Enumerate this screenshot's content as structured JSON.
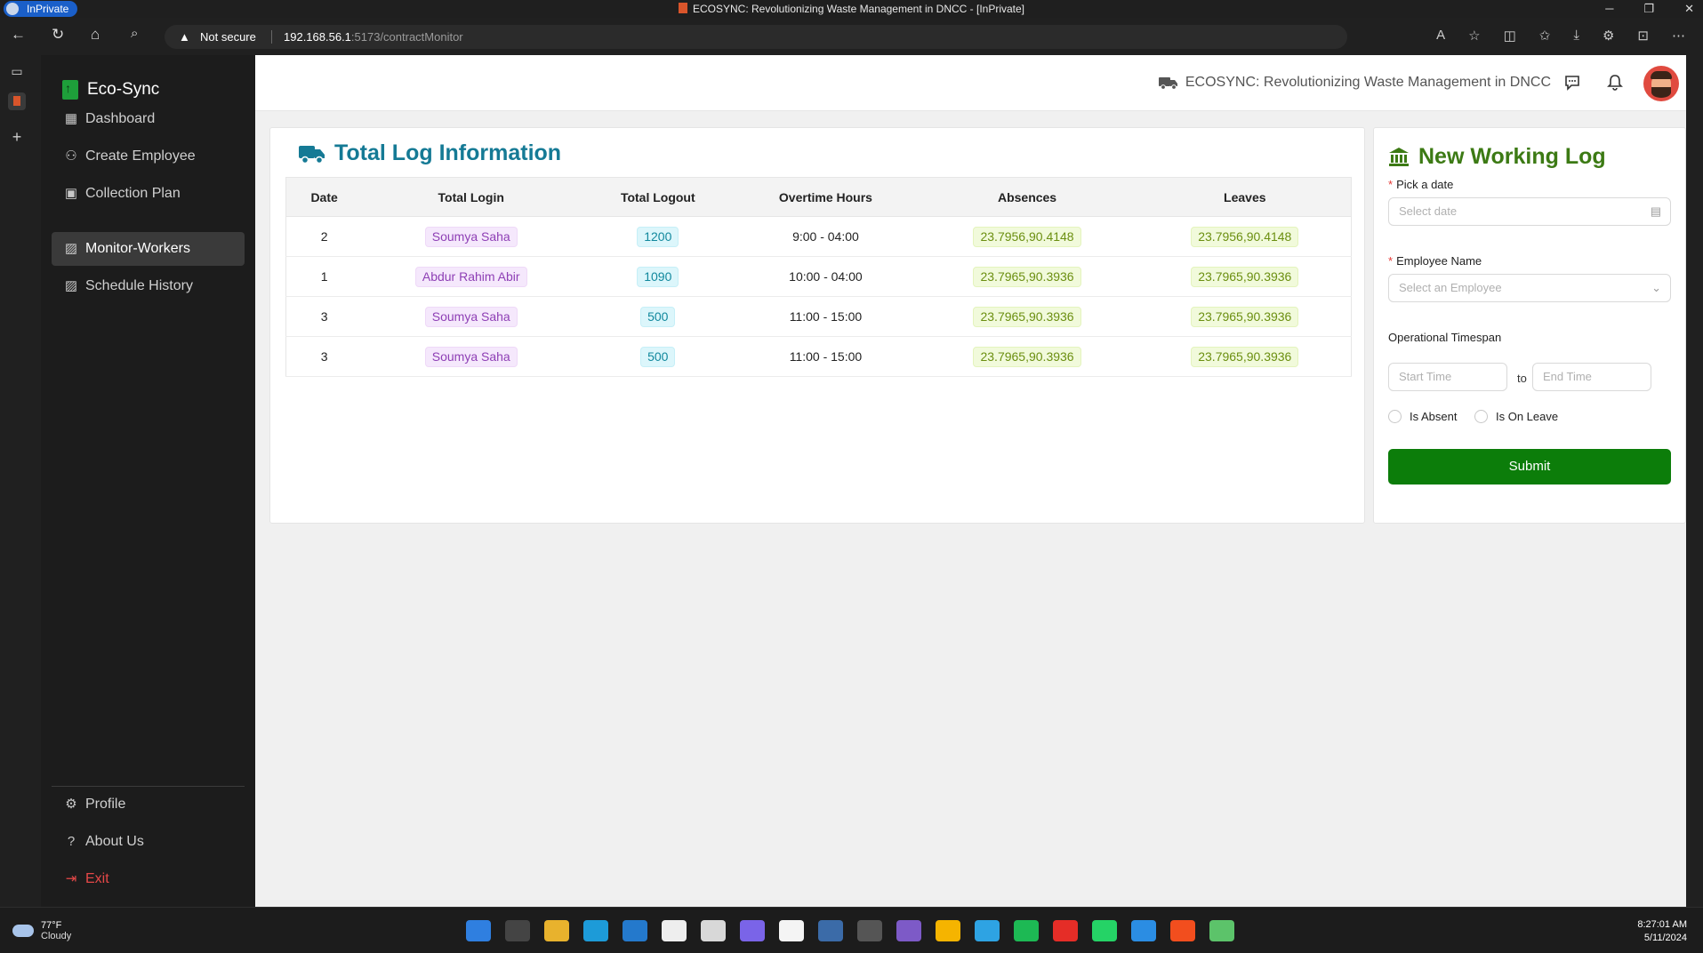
{
  "browser": {
    "inprivate_label": "InPrivate",
    "window_title": "ECOSYNC: Revolutionizing Waste Management in DNCC - [InPrivate]",
    "security_label": "Not secure",
    "url_host": "192.168.56.1",
    "url_path": ":5173/contractMonitor"
  },
  "sidebar": {
    "brand": "Eco-Sync",
    "items": [
      {
        "label": "Dashboard",
        "icon": "grid-icon"
      },
      {
        "label": "Create Employee",
        "icon": "users-icon"
      },
      {
        "label": "Collection Plan",
        "icon": "images-icon"
      },
      {
        "label": "Monitor-Workers",
        "icon": "monitor-icon",
        "active": true
      },
      {
        "label": "Schedule History",
        "icon": "schedule-icon"
      }
    ],
    "bottom_items": [
      {
        "label": "Profile",
        "icon": "gear-icon"
      },
      {
        "label": "About Us",
        "icon": "question-icon"
      },
      {
        "label": "Exit",
        "icon": "exit-icon"
      }
    ]
  },
  "header": {
    "title": "ECOSYNC: Revolutionizing Waste Management in DNCC"
  },
  "log_card": {
    "title": "Total Log Information",
    "columns": [
      "Date",
      "Total Login",
      "Total Logout",
      "Overtime Hours",
      "Absences",
      "Leaves"
    ],
    "rows": [
      {
        "date": "2",
        "login": "Soumya Saha",
        "logout": "1200",
        "overtime": "9:00 - 04:00",
        "absences": "23.7956,90.4148",
        "leaves": "23.7956,90.4148"
      },
      {
        "date": "1",
        "login": "Abdur Rahim Abir",
        "logout": "1090",
        "overtime": "10:00 - 04:00",
        "absences": "23.7965,90.3936",
        "leaves": "23.7965,90.3936"
      },
      {
        "date": "3",
        "login": "Soumya Saha",
        "logout": "500",
        "overtime": "11:00 - 15:00",
        "absences": "23.7965,90.3936",
        "leaves": "23.7965,90.3936"
      },
      {
        "date": "3",
        "login": "Soumya Saha",
        "logout": "500",
        "overtime": "11:00 - 15:00",
        "absences": "23.7965,90.3936",
        "leaves": "23.7965,90.3936"
      }
    ]
  },
  "form": {
    "title": "New Working Log",
    "date_label": "Pick a date",
    "date_placeholder": "Select date",
    "employee_label": "Employee Name",
    "employee_placeholder": "Select an Employee",
    "timespan_label": "Operational Timespan",
    "start_placeholder": "Start Time",
    "to_label": "to",
    "end_placeholder": "End Time",
    "absent_label": "Is Absent",
    "leave_label": "Is On Leave",
    "submit_label": "Submit"
  },
  "taskbar": {
    "temperature": "77°F",
    "condition": "Cloudy",
    "time": "8:27:01 AM",
    "date": "5/11/2024"
  },
  "colors": {
    "title_blue": "#157a95",
    "title_green": "#3c7a14",
    "submit_green": "#0c7d0a",
    "exit_red": "#e54848"
  }
}
